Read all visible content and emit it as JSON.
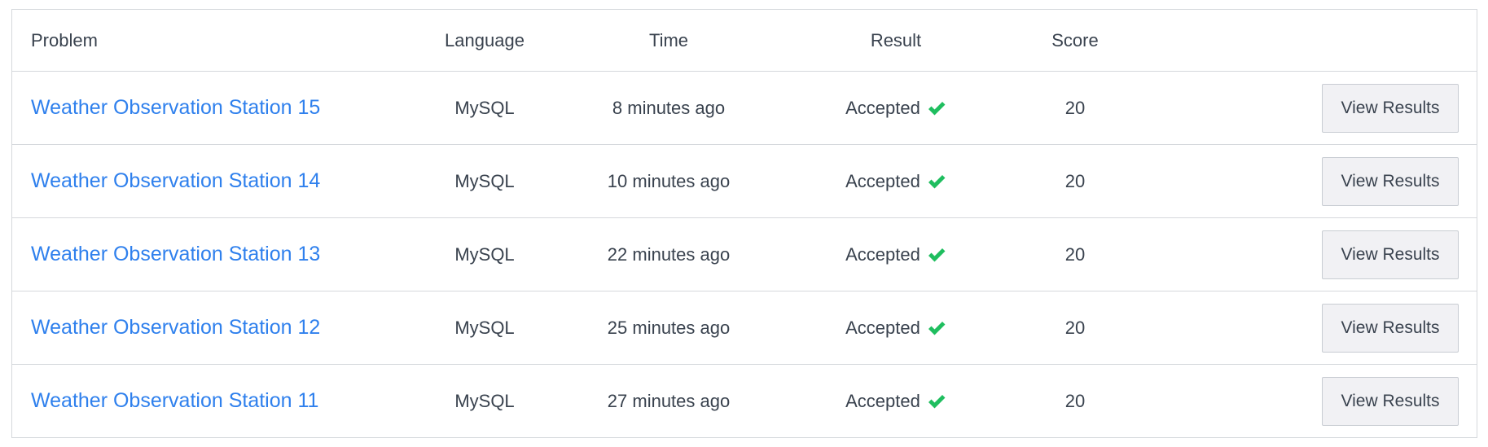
{
  "table": {
    "headers": {
      "problem": "Problem",
      "language": "Language",
      "time": "Time",
      "result": "Result",
      "score": "Score"
    },
    "rows": [
      {
        "problem": "Weather Observation Station 15",
        "language": "MySQL",
        "time": "8 minutes ago",
        "result": "Accepted",
        "score": "20",
        "action": "View Results"
      },
      {
        "problem": "Weather Observation Station 14",
        "language": "MySQL",
        "time": "10 minutes ago",
        "result": "Accepted",
        "score": "20",
        "action": "View Results"
      },
      {
        "problem": "Weather Observation Station 13",
        "language": "MySQL",
        "time": "22 minutes ago",
        "result": "Accepted",
        "score": "20",
        "action": "View Results"
      },
      {
        "problem": "Weather Observation Station 12",
        "language": "MySQL",
        "time": "25 minutes ago",
        "result": "Accepted",
        "score": "20",
        "action": "View Results"
      },
      {
        "problem": "Weather Observation Station 11",
        "language": "MySQL",
        "time": "27 minutes ago",
        "result": "Accepted",
        "score": "20",
        "action": "View Results"
      }
    ]
  },
  "colors": {
    "link": "#2f80ed",
    "accepted_check": "#1fbe5f",
    "border": "#d5d8dc",
    "button_bg": "#f1f1f4"
  },
  "icons": {
    "result_icon": "checkmark-icon"
  }
}
